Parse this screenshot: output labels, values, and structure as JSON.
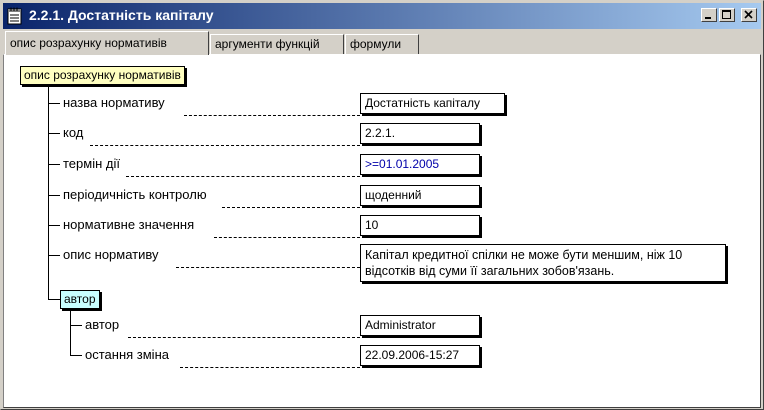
{
  "window": {
    "title": "2.2.1. Достатність капіталу",
    "icon": "notepad-icon",
    "controls": [
      "minimize-icon",
      "maximize-icon",
      "close-icon"
    ]
  },
  "tabs": [
    {
      "label": "опис розрахунку нормативів",
      "active": true
    },
    {
      "label": "аргументи функцій",
      "active": false
    },
    {
      "label": "формули",
      "active": false
    }
  ],
  "tree": {
    "root_label": "опис розрахунку нормативів",
    "fields": [
      {
        "label": "назва нормативу",
        "value": "Достатність капіталу"
      },
      {
        "label": "код",
        "value": "2.2.1."
      },
      {
        "label": "термін дії",
        "value": ">=01.01.2005"
      },
      {
        "label": "періодичність контролю",
        "value": "щоденний"
      },
      {
        "label": "нормативне значення",
        "value": "10"
      },
      {
        "label": "опис нормативу",
        "value": "Капітал кредитної спілки не може бути меншим,  ніж 10 відсотків від суми її загальних зобов'язань."
      }
    ],
    "author_group": {
      "label": "автор",
      "fields": [
        {
          "label": "автор",
          "value": "Administrator"
        },
        {
          "label": "остання зміна",
          "value": "22.09.2006-15:27"
        }
      ]
    }
  },
  "colors": {
    "titlebar_start": "#0a246a",
    "titlebar_end": "#a6caf0",
    "root_node": "#ffffc0",
    "group_node": "#c8ffff",
    "date_value": "#0000aa"
  }
}
